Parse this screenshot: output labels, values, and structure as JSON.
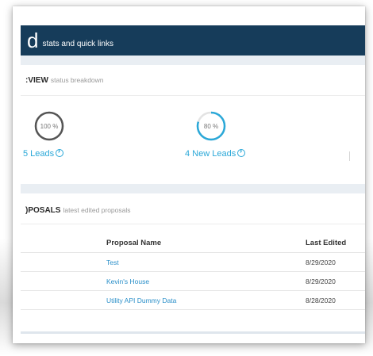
{
  "header": {
    "title_fragment": "d",
    "subtitle": "stats and quick links"
  },
  "overview": {
    "title_fragment": ":VIEW",
    "subtitle": "status breakdown",
    "rings": [
      {
        "label": "100 %",
        "percent": 100,
        "color": "#555555"
      },
      {
        "label": "80 %",
        "percent": 80,
        "color": "#2aa8d8"
      }
    ],
    "links": [
      {
        "text": "5 Leads"
      },
      {
        "text": "4 New Leads"
      }
    ]
  },
  "proposals": {
    "title_fragment": ")POSALS",
    "subtitle": "latest edited proposals",
    "columns": [
      "Proposal Name",
      "Last Edited"
    ],
    "rows": [
      {
        "name": "Test",
        "date": "8/29/2020"
      },
      {
        "name": "Kevin's House",
        "date": "8/29/2020"
      },
      {
        "name": "Utility API Dummy Data",
        "date": "8/28/2020"
      }
    ]
  },
  "colors": {
    "header_bg": "#163c5a",
    "link": "#2aa8d8",
    "band": "#e9eef3"
  }
}
